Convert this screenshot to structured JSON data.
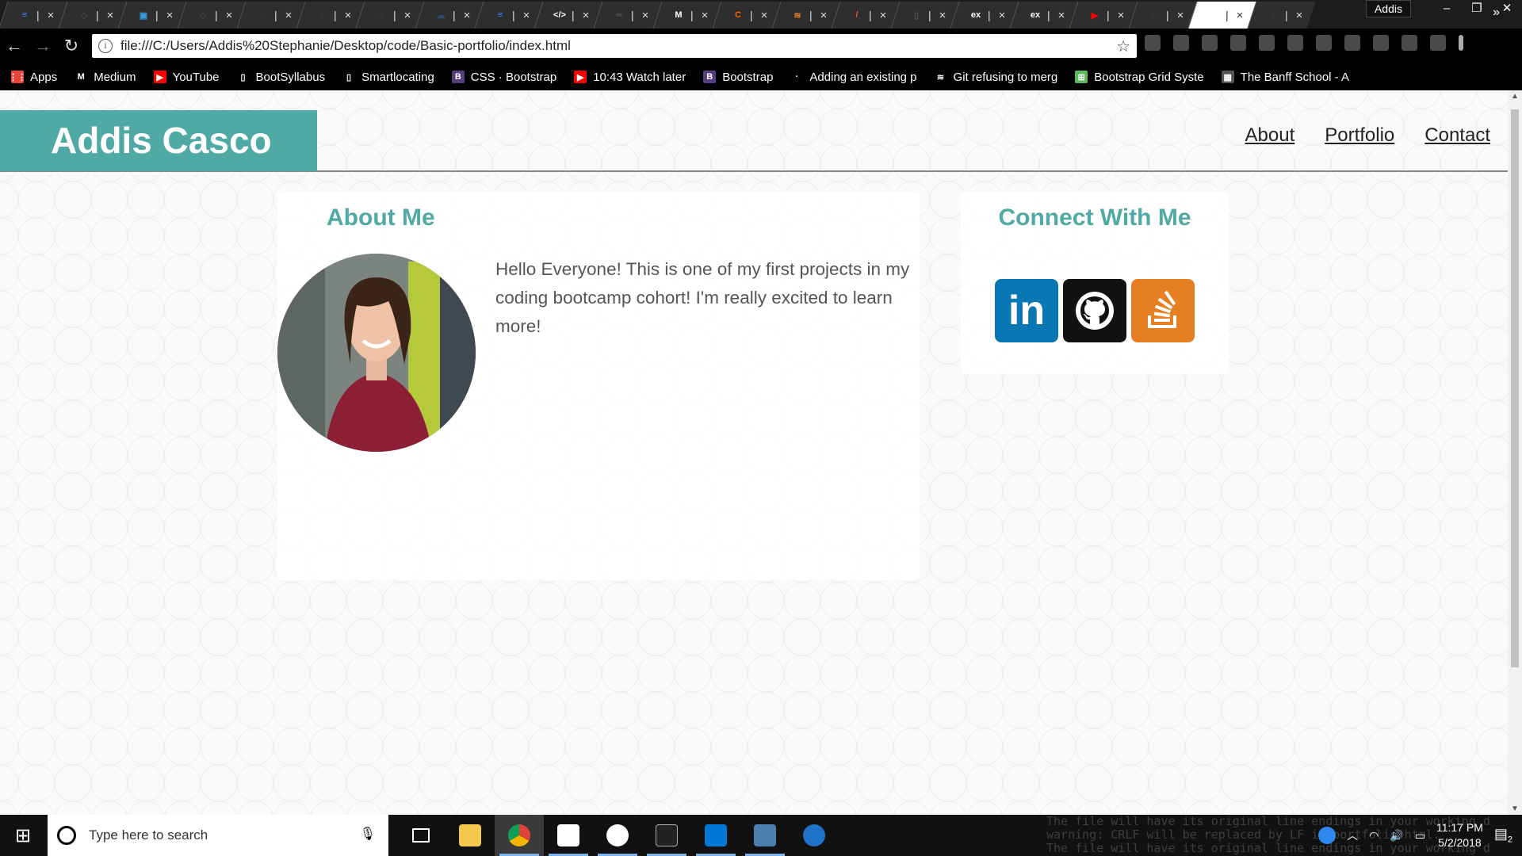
{
  "browser": {
    "profile_name": "Addis",
    "url": "file:///C:/Users/Addis%20Stephanie/Desktop/code/Basic-portfolio/index.html",
    "tabs": [
      {
        "icon": "docs-icon",
        "color": "#4285f4",
        "glyph": "≡"
      },
      {
        "icon": "codepen-icon",
        "color": "#444444",
        "glyph": "◇"
      },
      {
        "icon": "trello-icon",
        "color": "#3a9bd9",
        "glyph": "▣"
      },
      {
        "icon": "codepen-icon",
        "color": "#444444",
        "glyph": "◇"
      },
      {
        "icon": "github-icon",
        "color": "#333333",
        "glyph": "●"
      },
      {
        "icon": "github-icon",
        "color": "#333333",
        "glyph": "●"
      },
      {
        "icon": "github-icon",
        "color": "#333333",
        "glyph": "●"
      },
      {
        "icon": "cloud-icon",
        "color": "#2d4e6e",
        "glyph": "☁"
      },
      {
        "icon": "docs-icon",
        "color": "#4285f4",
        "glyph": "≡"
      },
      {
        "icon": "code-icon",
        "color": "#ffffff",
        "glyph": "</>"
      },
      {
        "icon": "link-icon",
        "color": "#555555",
        "glyph": "∞"
      },
      {
        "icon": "gmail-icon",
        "color": "#ffffff",
        "glyph": "M"
      },
      {
        "icon": "calendly-icon",
        "color": "#ff6600",
        "glyph": "C"
      },
      {
        "icon": "stackoverflow-icon",
        "color": "#f48024",
        "glyph": "≋"
      },
      {
        "icon": "postman-icon",
        "color": "#ef5b25",
        "glyph": "/"
      },
      {
        "icon": "page-icon",
        "color": "#555555",
        "glyph": "▯"
      },
      {
        "icon": "express-icon",
        "color": "#ffffff",
        "glyph": "ex"
      },
      {
        "icon": "express-icon",
        "color": "#ffffff",
        "glyph": "ex"
      },
      {
        "icon": "youtube-icon",
        "color": "#ff0000",
        "glyph": "▶"
      },
      {
        "icon": "github-icon",
        "color": "#333333",
        "glyph": "●"
      },
      {
        "icon": "page-icon",
        "color": "#ffffff",
        "glyph": "▯"
      },
      {
        "icon": "github-icon",
        "color": "#333333",
        "glyph": "●"
      }
    ],
    "bookmarks": [
      {
        "label": "Apps",
        "icon": "apps-grid-icon",
        "color": "#e8453c",
        "glyph": "⋮⋮"
      },
      {
        "label": "Medium",
        "icon": "medium-icon",
        "color": "#000000",
        "glyph": "M"
      },
      {
        "label": "YouTube",
        "icon": "youtube-icon",
        "color": "#ff0000",
        "glyph": "▶"
      },
      {
        "label": "BootSyllabus",
        "icon": "page-icon",
        "color": "#000000",
        "glyph": "▯"
      },
      {
        "label": "Smartlocating",
        "icon": "page-icon",
        "color": "#000000",
        "glyph": "▯"
      },
      {
        "label": "CSS · Bootstrap",
        "icon": "bootstrap-icon",
        "color": "#563d7c",
        "glyph": "B"
      },
      {
        "label": "10:43 Watch later",
        "icon": "youtube-icon",
        "color": "#ff0000",
        "glyph": "▶"
      },
      {
        "label": "Bootstrap",
        "icon": "bootstrap-icon",
        "color": "#563d7c",
        "glyph": "B"
      },
      {
        "label": "Adding an existing p",
        "icon": "dot-icon",
        "color": "#000000",
        "glyph": "·"
      },
      {
        "label": "Git refusing to merg",
        "icon": "stackoverflow-icon",
        "color": "#000000",
        "glyph": "≋"
      },
      {
        "label": "Bootstrap Grid Syste",
        "icon": "grid-icon",
        "color": "#5cb85c",
        "glyph": "⊞"
      },
      {
        "label": "The Banff School - A",
        "icon": "page-icon",
        "color": "#555555",
        "glyph": "▦"
      }
    ],
    "more_bookmarks": "»"
  },
  "site": {
    "brand": "Addis Casco",
    "nav": [
      {
        "label": "About",
        "name": "nav-about-link"
      },
      {
        "label": "Portfolio",
        "name": "nav-portfolio-link"
      },
      {
        "label": "Contact",
        "name": "nav-contact-link"
      }
    ],
    "about": {
      "title": "About Me",
      "text": "Hello Everyone! This is one of my first projects in my coding bootcamp cohort! I'm really excited to learn more!"
    },
    "connect": {
      "title": "Connect With Me",
      "socials": [
        {
          "name": "linkedin-icon",
          "label": "in"
        },
        {
          "name": "github-icon",
          "label": ""
        },
        {
          "name": "stackoverflow-icon",
          "label": ""
        }
      ]
    },
    "accent_color": "#4fa9a5"
  },
  "taskbar": {
    "search_placeholder": "Type here to search",
    "time": "11:17 PM",
    "date": "5/2/2018",
    "notifications": "2",
    "terminal_text": [
      "The file will have its original line endings in your working dire",
      "warning: CRLF will be replaced by LF in portfolio.html.",
      "The file will have its original line endings in your working dire"
    ]
  }
}
